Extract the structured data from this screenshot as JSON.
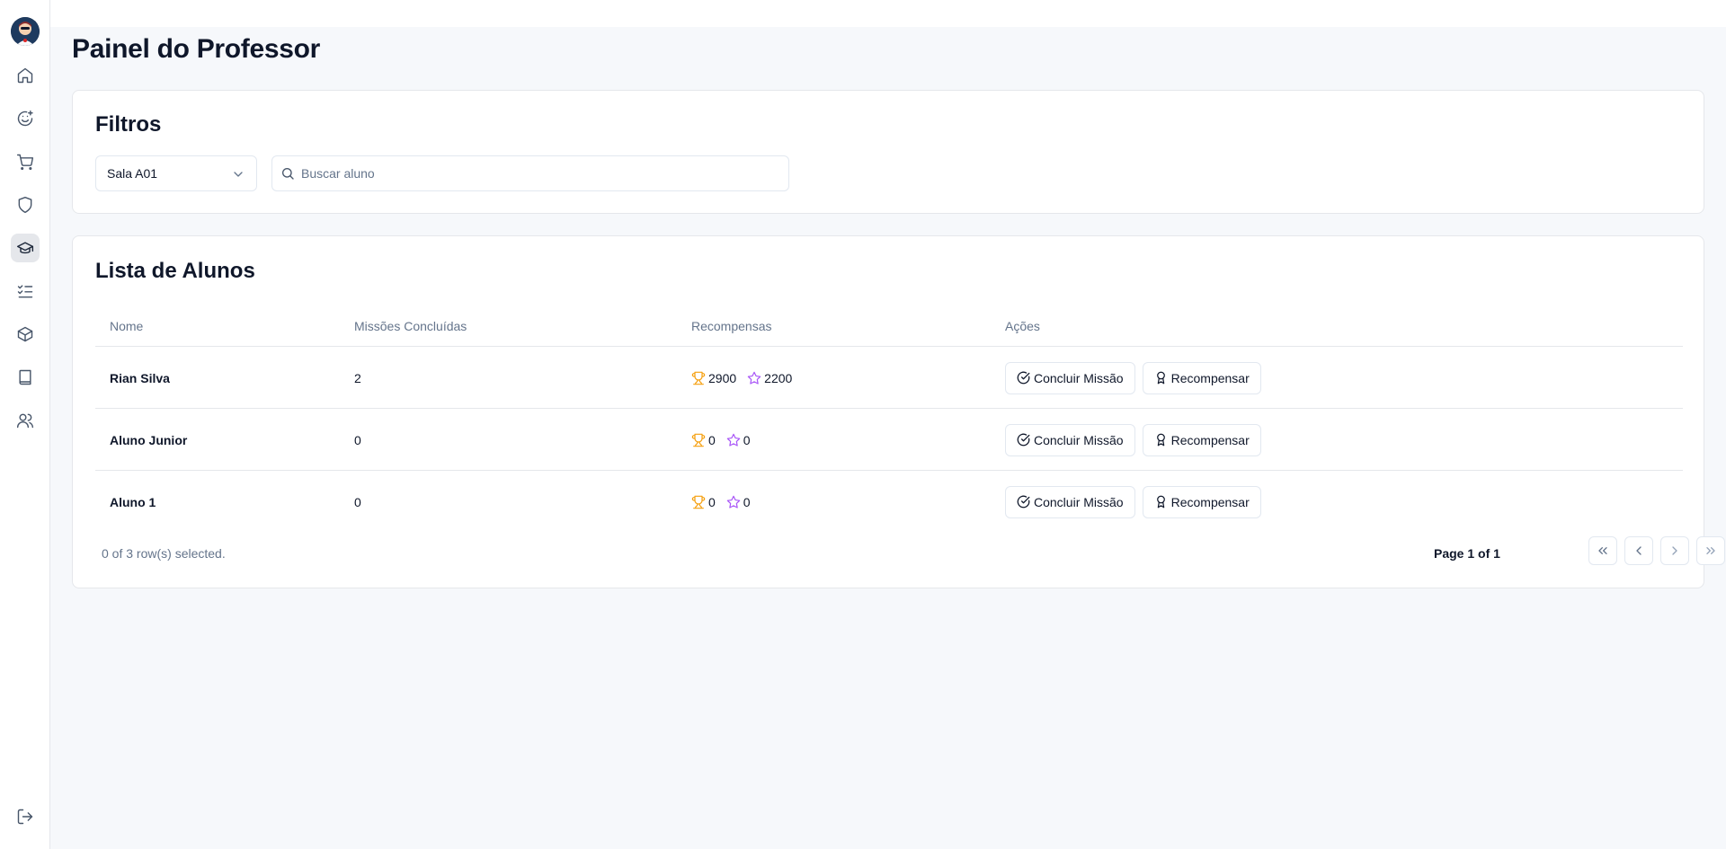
{
  "page": {
    "title": "Painel do Professor"
  },
  "sidebar": {
    "items": [
      {
        "icon": "home-icon"
      },
      {
        "icon": "smile-plus-icon"
      },
      {
        "icon": "shopping-cart-icon"
      },
      {
        "icon": "shield-icon"
      },
      {
        "icon": "graduation-cap-icon",
        "active": true
      },
      {
        "icon": "list-checks-icon"
      },
      {
        "icon": "package-icon"
      },
      {
        "icon": "book-icon"
      },
      {
        "icon": "users-icon"
      }
    ],
    "logout_icon": "log-out-icon"
  },
  "filters": {
    "title": "Filtros",
    "class_select": {
      "value": "Sala A01"
    },
    "search": {
      "placeholder": "Buscar aluno",
      "value": ""
    }
  },
  "students": {
    "title": "Lista de Alunos",
    "columns": [
      "Nome",
      "Missões Concluídas",
      "Recompensas",
      "Ações"
    ],
    "rows": [
      {
        "name": "Rian Silva",
        "missions": "2",
        "trophies": "2900",
        "stars": "2200"
      },
      {
        "name": "Aluno Junior",
        "missions": "0",
        "trophies": "0",
        "stars": "0"
      },
      {
        "name": "Aluno 1",
        "missions": "0",
        "trophies": "0",
        "stars": "0"
      }
    ],
    "actions": {
      "complete_label": "Concluir Missão",
      "reward_label": "Recompensar"
    },
    "selection_text": "0 of 3 row(s) selected.",
    "page_info": "Page 1 of 1"
  },
  "colors": {
    "trophy": "#f59e0b",
    "star": "#a855f7",
    "active_nav_bg": "#e5e7eb"
  }
}
